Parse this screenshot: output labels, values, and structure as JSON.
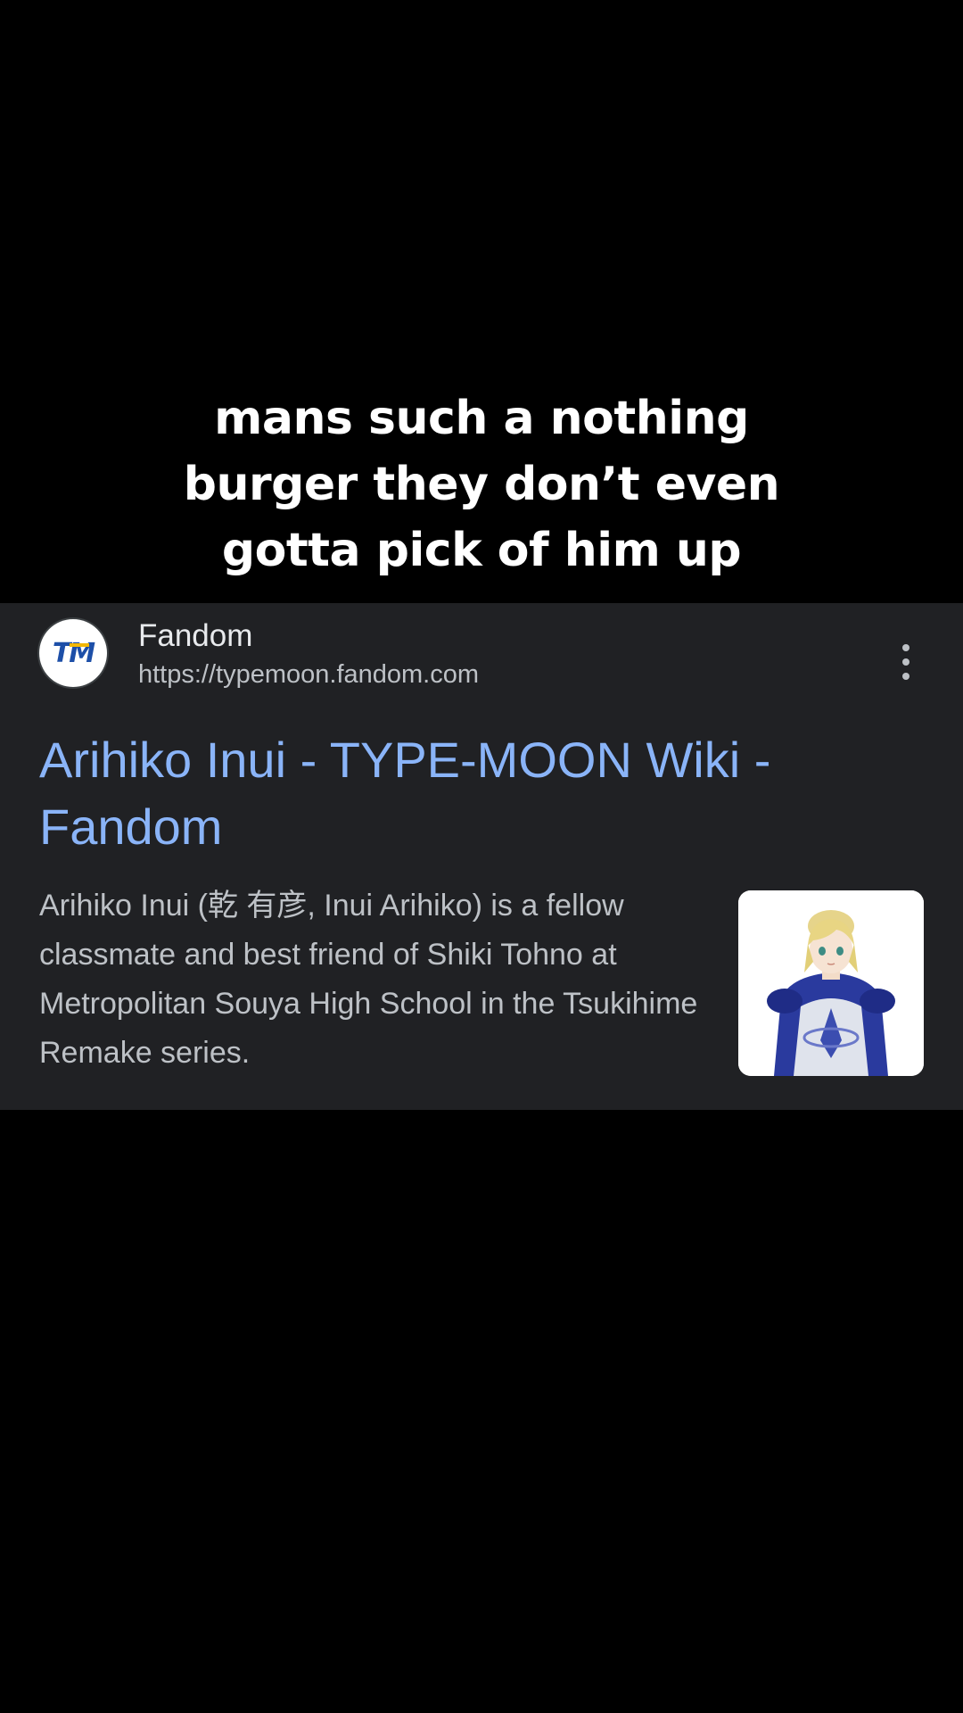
{
  "caption": {
    "lines": [
      "mans such a nothing",
      "burger they don’t even",
      "gotta pick of him up"
    ]
  },
  "result": {
    "favicon_text": "TM",
    "site_name": "Fandom",
    "site_url": "https://typemoon.fandom.com",
    "more_icon": "more-vert-icon",
    "title": "Arihiko Inui - TYPE-MOON Wiki - Fandom",
    "snippet": "Arihiko Inui (乾 有彦, Inui Arihiko) is a fellow classmate and best friend of Shiki Tohno at Metropolitan Souya High School in the Tsukihime Remake series.",
    "thumbnail": "anime-character-thumbnail"
  },
  "colors": {
    "background": "#000000",
    "card": "#202124",
    "title_link": "#8ab4f8",
    "text_primary": "#e8eaed",
    "text_secondary": "#bdc1c6"
  }
}
